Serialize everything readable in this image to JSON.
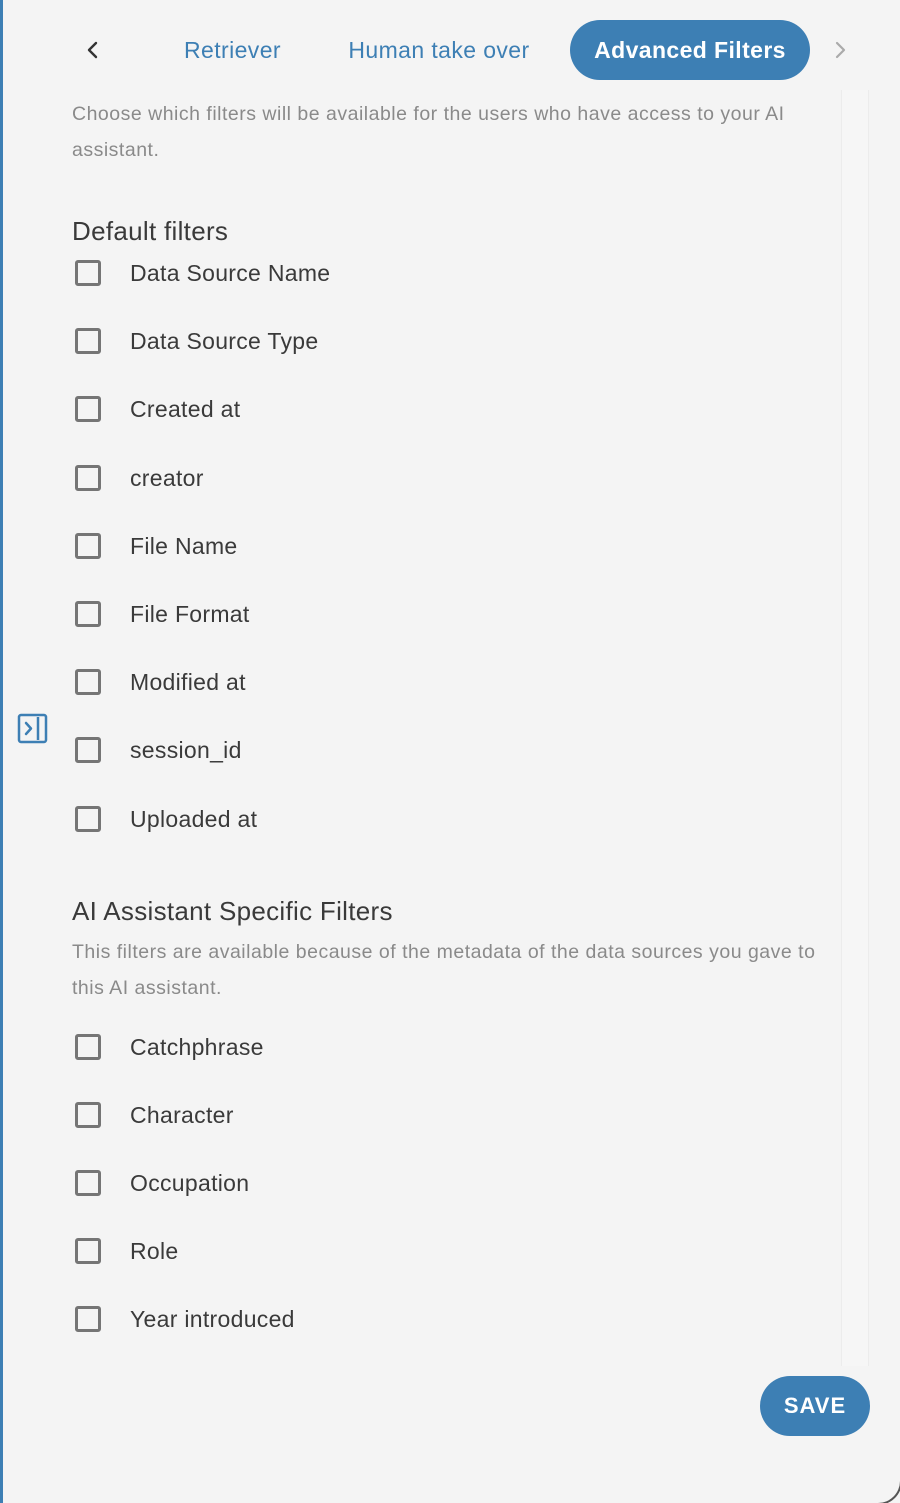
{
  "colors": {
    "accent": "#3d7fb4",
    "background": "#f4f4f4",
    "text": "#3a3a3a",
    "muted": "#8a8a8a",
    "checkbox_border": "#757575"
  },
  "tabs": {
    "prev_icon": "chevron-left-icon",
    "next_icon": "chevron-right-icon",
    "items": [
      {
        "label": "Retriever",
        "active": false
      },
      {
        "label": "Human take over",
        "active": false
      },
      {
        "label": "Advanced Filters",
        "active": true
      }
    ]
  },
  "advanced_filters": {
    "description": "Choose which filters will be available for the users who have access to your AI assistant.",
    "default_section": {
      "title": "Default filters",
      "items": [
        {
          "label": "Data Source Name",
          "checked": false
        },
        {
          "label": "Data Source Type",
          "checked": false
        },
        {
          "label": "Created at",
          "checked": false
        },
        {
          "label": "creator",
          "checked": false
        },
        {
          "label": "File Name",
          "checked": false
        },
        {
          "label": "File Format",
          "checked": false
        },
        {
          "label": "Modified at",
          "checked": false
        },
        {
          "label": "session_id",
          "checked": false
        },
        {
          "label": "Uploaded at",
          "checked": false
        }
      ]
    },
    "ai_section": {
      "title": "AI Assistant Specific Filters",
      "description": "This filters are available because of the metadata of the data sources you gave to this AI assistant.",
      "items": [
        {
          "label": "Catchphrase",
          "checked": false
        },
        {
          "label": "Character",
          "checked": false
        },
        {
          "label": "Occupation",
          "checked": false
        },
        {
          "label": "Role",
          "checked": false
        },
        {
          "label": "Year introduced",
          "checked": false
        }
      ]
    }
  },
  "sidebar_toggle": {
    "icon": "sidebar-expand-icon"
  },
  "actions": {
    "save_label": "SAVE"
  }
}
